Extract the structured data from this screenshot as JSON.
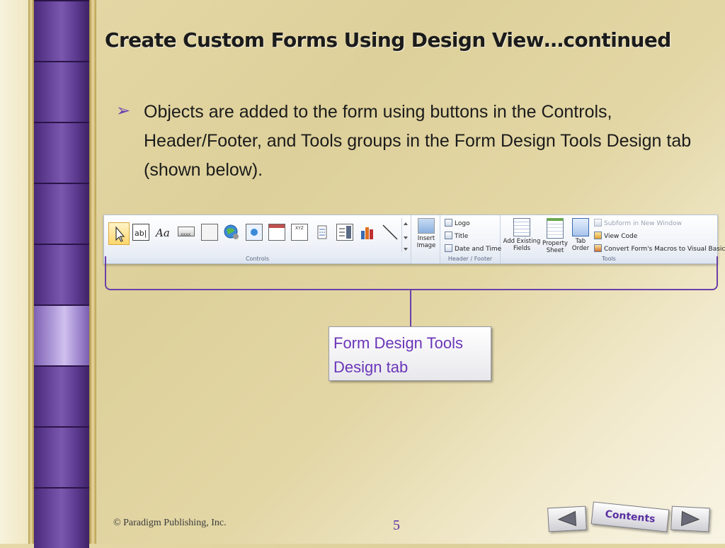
{
  "slide": {
    "title": "Create Custom Forms Using Design View…continued",
    "bullet": "Objects are added to the form using buttons in the Controls, Header/Footer, and Tools groups in the Form Design Tools Design tab (shown below).",
    "callout": "Form Design Tools Design tab",
    "footer": "© Paradigm Publishing, Inc.",
    "page_number": "5",
    "nav": {
      "previous_icon": "triangle-left-icon",
      "contents_label": "Contents",
      "next_icon": "triangle-right-icon"
    }
  },
  "ribbon": {
    "controls_group_label": "Controls",
    "insert_image_label": "Insert Image",
    "header_footer_group_label": "Header / Footer",
    "header_footer_items": [
      "Logo",
      "Title",
      "Date and Time"
    ],
    "add_existing_fields_label": "Add Existing Fields",
    "property_sheet_label": "Property Sheet",
    "tab_order_label": "Tab Order",
    "tools_items": [
      "Subform in New Window",
      "View Code",
      "Convert Form's Macros to Visual Basic"
    ],
    "tools_group_label": "Tools"
  },
  "colors": {
    "accent_purple": "#6b3fa8",
    "callout_text": "#6a35b8",
    "filmstrip_dark": "#3a1f63"
  }
}
